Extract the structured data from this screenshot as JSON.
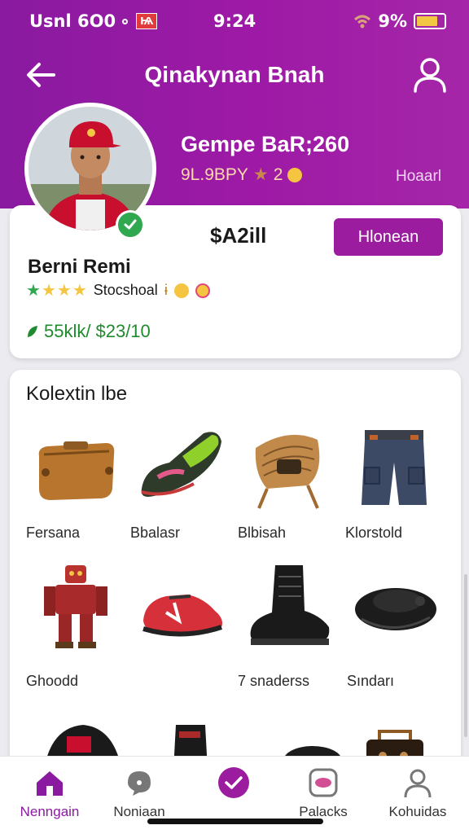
{
  "status_bar": {
    "carrier": "Usnl 6O0",
    "carrier_badge": "Ѩ",
    "time": "9:24",
    "battery": "9%"
  },
  "header": {
    "title": "Qinakynan Bnah",
    "name": "Gempe BaR;260",
    "subtitle": "9L.9BPY",
    "subtitle_extra": "2",
    "link": "Hoaarl"
  },
  "profile_card": {
    "price": "$A2ill",
    "button_label": "Hlonean",
    "user_name": "Berni Remi",
    "rating_text": "Stocshoal",
    "rating_extra": "ɨ",
    "stats_primary": "55klk/",
    "stats_secondary": "$23/10"
  },
  "collection": {
    "title": "Kolextin lbe",
    "items": [
      {
        "label": "Fersana",
        "icon": "leather-bag-icon"
      },
      {
        "label": "Bbalasr",
        "icon": "sneaker-icon"
      },
      {
        "label": "Blbisah",
        "icon": "basket-chair-icon"
      },
      {
        "label": "Klorstold",
        "icon": "cargo-shorts-icon"
      },
      {
        "label": "Ghoodd",
        "icon": "robot-figure-icon"
      },
      {
        "label": "7 snaderss",
        "icon": "running-shoe-icon"
      },
      {
        "label": "Sındarı",
        "icon": "combat-boot-icon"
      },
      {
        "label": "",
        "icon": "black-pouch-icon"
      }
    ]
  },
  "bottom_nav": [
    {
      "label": "Nenngain",
      "icon": "home-icon",
      "active": true
    },
    {
      "label": "Noniaan",
      "icon": "chat-icon",
      "active": false
    },
    {
      "label": "",
      "icon": "check-circle-icon",
      "active": false
    },
    {
      "label": "Palacks",
      "icon": "media-icon",
      "active": false
    },
    {
      "label": "Kohuidas",
      "icon": "person-icon",
      "active": false
    }
  ],
  "colors": {
    "brand": "#9b1c9e",
    "header_gradient_start": "#8a1aa0",
    "success": "#2fa84f",
    "stats": "#1f8a2e"
  }
}
